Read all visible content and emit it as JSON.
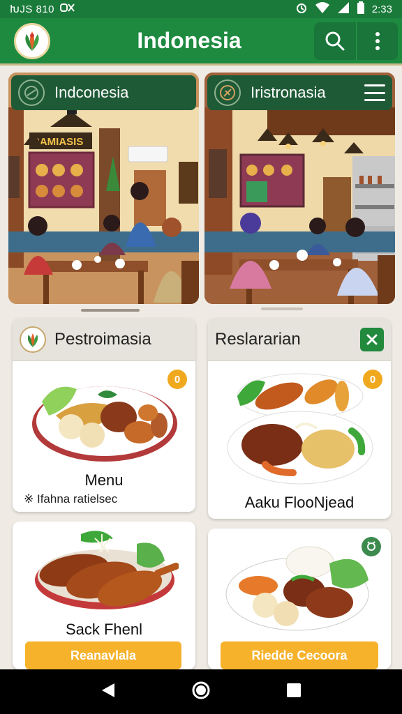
{
  "status_bar": {
    "left_text": "ԽJS 810",
    "time": "2:33"
  },
  "app_bar": {
    "title": "Indonesia"
  },
  "banners": [
    {
      "title": "Indconesia",
      "sign": "RAMIASIS"
    },
    {
      "title": "Iristronasia"
    }
  ],
  "cards": [
    {
      "head_title": "Pestroimasia",
      "badge": "0",
      "label": "Menu",
      "sub": "※ Ifahna ratielsec"
    },
    {
      "head_title": "Reslararian",
      "badge": "0",
      "label": "Aaku FlooNjead"
    },
    {
      "label": "Sack Fhenl",
      "button": "Reanavlala"
    },
    {
      "label": "",
      "button": "Riedde Cecoora"
    }
  ],
  "colors": {
    "primary_green": "#1d8a40",
    "dark_green": "#1f5a37",
    "accent_orange": "#f6b22b"
  },
  "icons": {
    "search": "search-icon",
    "more": "more-vertical-icon",
    "close": "close-icon",
    "back": "back-triangle-icon",
    "home": "home-circle-icon",
    "recents": "recents-square-icon"
  }
}
